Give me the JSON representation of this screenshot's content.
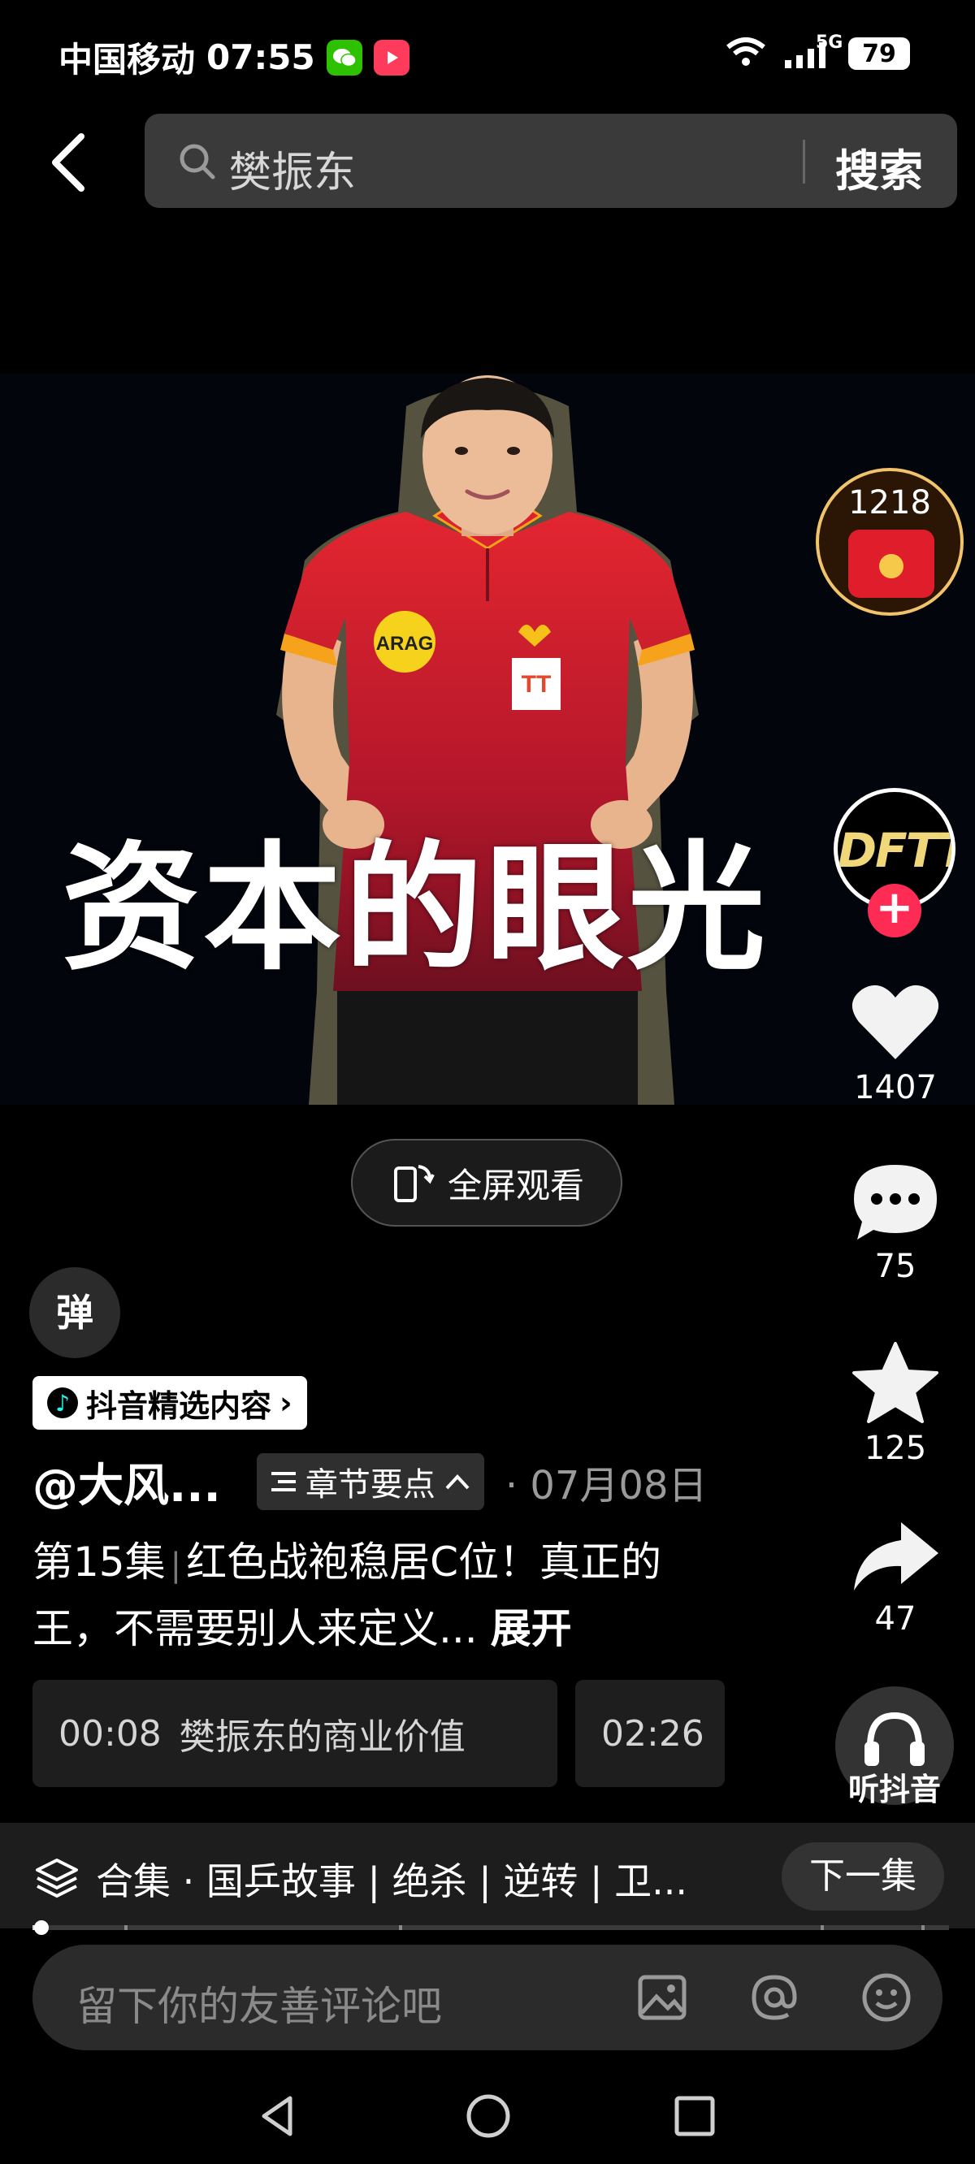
{
  "status_bar": {
    "carrier": "中国移动",
    "time": "07:55",
    "network": "5G",
    "battery": "79"
  },
  "search": {
    "query": "樊振东",
    "button_label": "搜索"
  },
  "video": {
    "overlay_title": "资本的眼光"
  },
  "red_packet": {
    "count": "1218"
  },
  "author_avatar": {
    "logo_text": "DFTT"
  },
  "actions": {
    "likes": "1407",
    "comments": "75",
    "favorites": "125",
    "shares": "47",
    "listen_label": "听抖音"
  },
  "fullscreen_label": "全屏观看",
  "danmaku_label": "弹",
  "featured_badge": "抖音精选内容",
  "post": {
    "author": "@大风...",
    "chapters_label": "章节要点",
    "date": "07月08日",
    "episode": "第15集",
    "description": "红色战袍稳居C位！真正的王，不需要别人来定义...",
    "expand_label": "展开"
  },
  "chapters": [
    {
      "time": "00:08",
      "title": "樊振东的商业价值"
    },
    {
      "time": "02:26",
      "title": ""
    }
  ],
  "collection": {
    "text": "合集 · 国乒故事 | 绝杀 | 逆转 | 卫...",
    "next_label": "下一集"
  },
  "progress": {
    "fraction": 0.01,
    "chapter_marks": [
      0.1,
      0.4,
      0.86,
      0.97
    ]
  },
  "comment": {
    "placeholder": "留下你的友善评论吧"
  },
  "colors": {
    "accent": "#fe2c55",
    "background": "#000000"
  }
}
